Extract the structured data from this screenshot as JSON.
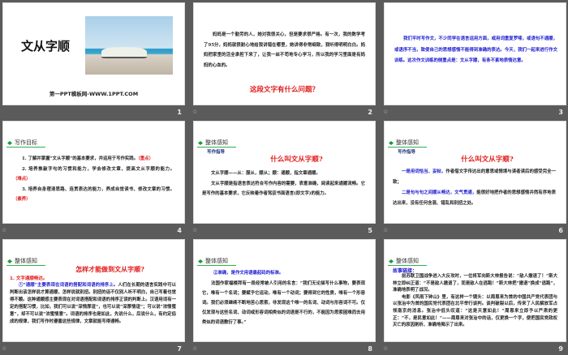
{
  "slides": [
    {
      "num": "1",
      "title": "文从字顺",
      "footer": "第一PPT模板网-WWW.1PPT.COM"
    },
    {
      "num": "2",
      "para": "妈妈是一个勤劳的人，她对我很关心，但是要求很严格。有一次，我的数学考了95分，妈妈就很耐心地给我讲错在哪里，她讲得非常细致，我听得明明白白。妈妈把家里的活全承担下来了，让我一丝不苟地专心学习，所以我的学习里面是有妈妈的心血的。",
      "question": "这段文字有什么问题？"
    },
    {
      "num": "3",
      "para": "我们平时写作文，不少同学在语言运用方面，或用词重复罗嗦，或语句不通顺，或语序不当，致使自己的思想感情不能得到准确的表达。今天，我们一起来进行作文训练。这次作文训练的侧重点是：文从字顺，有条不紊地表情达意。"
    },
    {
      "num": "4",
      "section": "写作目标",
      "items": [
        {
          "text": "1. 了解并掌握“文从字顺”的基本要求，并运用于写作实践。",
          "tag": "（重点）"
        },
        {
          "text": "2. 培养推敲字句的习惯和能力，学会修改文章，提高文从字顺的能力。",
          "tag": "（难点）"
        },
        {
          "text": "3. 培养自身理清思路、连贯表达的能力，养成自觉读书、修改文章的习惯。",
          "tag": "（素养）"
        }
      ]
    },
    {
      "num": "5",
      "section": "整体感知",
      "sub": "写作指导",
      "question": "什么叫文从字顺?",
      "paras": [
        "文从字顺——从：服从，顺从；顺：通顺，指文章通顺。",
        "文从字顺是指语言表达符合写作内容的需要，表意准确，阅读起来通顺流畅。它是写作的基本要求，它反映着作者驾驭书面语言(即文字)的能力。"
      ]
    },
    {
      "num": "6",
      "section": "整体感知",
      "sub": "写作指导",
      "question": "什么叫文从字顺?",
      "p1_blue": "一是用词恰当、妥帖，",
      "p1": "作者借文字传达出的意思或情境与读者读后的感受完全一致；",
      "p2_blue": "二是句与句之间顺从畅达，文气贯通，",
      "p2": "能很好地把作者的思想感情井然有序地表达出来，没有任何含混、错乱和别扭之处。"
    },
    {
      "num": "7",
      "section": "整体感知",
      "question": "怎样才能做到文从字顺?",
      "point": "1. 文字通顺畅达。",
      "lead_blue": "①“通顺”主要表现在词语的搭配和词语的排序上。",
      "para": "人们在长期的语言实践中可以判断出该怎样说才算通顺，怎样说就别扭。别扭的话不仅别人听不明白，自己写着也觉得不顺。这种通顺感主要表现在对词语搭配和词语的排序正误的判断上。汉语用词有一定的搭配习惯，比如，我们可以说“深情厚谊”，也可以说“深厚情谊”；可以说“浓情蜜意”，却不可以说“浓蜜情意”。词语的排序也是如此，先说什么，后说什么，有约定俗成的规律，我们写作时遵循这些规律，文章就能写得通畅。"
    },
    {
      "num": "8",
      "section": "整体感知",
      "lead_blue": "②准确，是作文用语最起码的标准。",
      "para": "法国作家福楼拜有一段经常被人引用的名言：“我们无论描写什么事物，要表现它，唯有一个名词；要赋予它运动，唯有一个动词；要得到它的性质，唯有一个形容词。我们必须继续不断地苦心思索，非发现这个唯一的名词、动词与形容词不可。仅仅发现与这些名词、动词或形容词相类似的词语是不行的，不能因为思索困难而去用类似的词语敷衍了事。”"
    },
    {
      "num": "9",
      "section": "整体感知",
      "sub": "故事链接：",
      "paras": [
        "前苏联卫国战争进入大反攻时，一位将军向斯大林报告说：“敌人撤退了！”斯大林立即纠正道：“不是敌人撤退了，而是敌人在逃跑！”斯大林把“撤退”换成“逃跑”，准确地表明了战况。",
        "电影《风雨下钟山》里，有这样一个镜头：以周恩来为首的中国共产党代表团与以张治中为首的国民党代表团在北平举行谈判。谈判破裂以后，传来了人民解放军占领南京的消息。张治中低头叹道：“这是天意如此！”周恩来立即予以严肃的更正：“不，是民意如此！”——周恩来对张治中的话，仅更换一个字，便把国民党政权灭亡的原因剖析、准确地揭示了出来。"
      ]
    }
  ],
  "colors": {
    "red": "#e21b1b",
    "blue": "#1a1ad0",
    "green": "#1a9a3a",
    "bg": "#5b5b5b"
  }
}
